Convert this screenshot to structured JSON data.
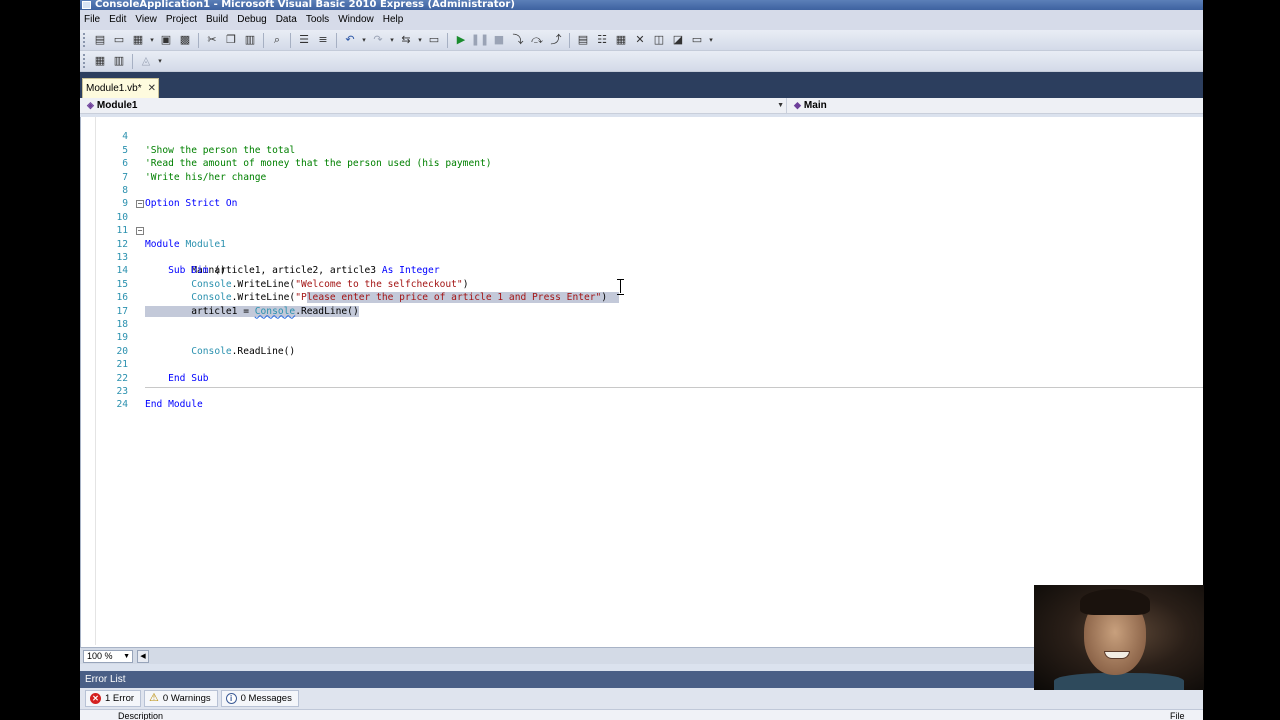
{
  "window": {
    "title": "ConsoleApplication1 - Microsoft Visual Basic 2010 Express (Administrator)"
  },
  "menu": {
    "items": [
      "File",
      "Edit",
      "View",
      "Project",
      "Build",
      "Debug",
      "Data",
      "Tools",
      "Window",
      "Help"
    ]
  },
  "toolbar": {
    "icons": [
      "new-project-icon",
      "open-file-icon",
      "add-item-icon",
      "save-icon",
      "save-all-icon",
      "cut-icon",
      "copy-icon",
      "paste-icon",
      "find-icon",
      "comment-icon",
      "uncomment-icon",
      "undo-icon",
      "redo-icon",
      "navigate-icon",
      "start-debugging-icon",
      "pause-icon",
      "stop-icon",
      "step-into-icon",
      "step-over-icon",
      "step-out-icon",
      "solution-explorer-icon",
      "properties-icon",
      "object-browser-icon",
      "toolbox-icon",
      "extension-manager-icon"
    ],
    "second_icons": [
      "format-table-icon",
      "grid-icon",
      "align-icon"
    ]
  },
  "tabs": [
    {
      "label": "Module1.vb*",
      "active": true
    }
  ],
  "navbar": {
    "left": "Module1",
    "right": "Main"
  },
  "editor": {
    "lines": [
      {
        "n": "4",
        "text": "'Show the person the total"
      },
      {
        "n": "5",
        "text": "'Read the amount of money that the person used (his payment)"
      },
      {
        "n": "6",
        "text": "'Write his/her change"
      },
      {
        "n": "7",
        "text": ""
      },
      {
        "n": "8",
        "text": "Option Strict On"
      },
      {
        "n": "9",
        "text": ""
      },
      {
        "n": "10",
        "text": "Module Module1"
      },
      {
        "n": "11",
        "text": ""
      },
      {
        "n": "12",
        "text": "    Sub Main()"
      },
      {
        "n": "13",
        "text": "        Dim article1, article2, article3 As Integer"
      },
      {
        "n": "14",
        "text": "        Console.WriteLine(\"Welcome to the selfcheckout\")"
      },
      {
        "n": "15",
        "text": "        Console.WriteLine(\"Please enter the price of article 1 and Press Enter\")"
      },
      {
        "n": "16",
        "text": "        article1 = Console.ReadLine()"
      },
      {
        "n": "17",
        "text": ""
      },
      {
        "n": "18",
        "text": ""
      },
      {
        "n": "19",
        "text": "        Console.ReadLine()"
      },
      {
        "n": "20",
        "text": ""
      },
      {
        "n": "21",
        "text": "    End Sub"
      },
      {
        "n": "22",
        "text": ""
      },
      {
        "n": "23",
        "text": "End Module"
      },
      {
        "n": "24",
        "text": ""
      }
    ]
  },
  "zoom": {
    "value": "100 %"
  },
  "error_list": {
    "title": "Error List",
    "errors": "1 Error",
    "warnings": "0 Warnings",
    "messages": "0 Messages",
    "col_description": "Description",
    "col_file": "File"
  },
  "colors": {
    "keyword": "#0000ff",
    "comment": "#008000",
    "string": "#a31515",
    "type": "#2b91af",
    "selection": "#c3c9d9"
  }
}
